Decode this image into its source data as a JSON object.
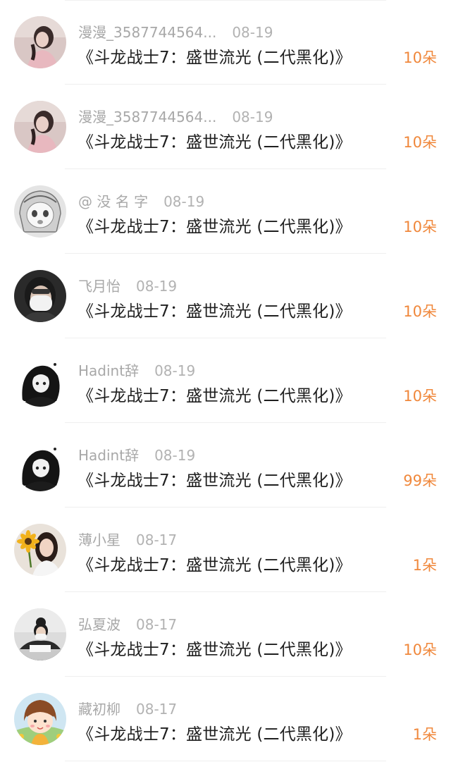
{
  "gifts": [
    {
      "user": "漫漫_3587744564...",
      "date": "08-19",
      "title": "《斗龙战士7：盛世流光 (二代黑化)》",
      "amount": "10朵",
      "avatar": "girl-pink-avatar"
    },
    {
      "user": "漫漫_3587744564...",
      "date": "08-19",
      "title": "《斗龙战士7：盛世流光 (二代黑化)》",
      "amount": "10朵",
      "avatar": "girl-pink-avatar"
    },
    {
      "user": "@ 没 名 字",
      "date": "08-19",
      "title": "《斗龙战士7：盛世流光 (二代黑化)》",
      "amount": "10朵",
      "avatar": "anime-girl-avatar"
    },
    {
      "user": "飞月怡",
      "date": "08-19",
      "title": "《斗龙战士7：盛世流光 (二代黑化)》",
      "amount": "10朵",
      "avatar": "masked-person-avatar"
    },
    {
      "user": "Hadint辞",
      "date": "08-19",
      "title": "《斗龙战士7：盛世流光 (二代黑化)》",
      "amount": "10朵",
      "avatar": "dark-anime-avatar"
    },
    {
      "user": "Hadint辞",
      "date": "08-19",
      "title": "《斗龙战士7：盛世流光 (二代黑化)》",
      "amount": "99朵",
      "avatar": "dark-anime-avatar"
    },
    {
      "user": "薄小星",
      "date": "08-17",
      "title": "《斗龙战士7：盛世流光 (二代黑化)》",
      "amount": "1朵",
      "avatar": "sunflower-girl-avatar"
    },
    {
      "user": "弘夏波",
      "date": "08-17",
      "title": "《斗龙战士7：盛世流光 (二代黑化)》",
      "amount": "10朵",
      "avatar": "person-desk-avatar"
    },
    {
      "user": "藏初柳",
      "date": "08-17",
      "title": "《斗龙战士7：盛世流光 (二代黑化)》",
      "amount": "1朵",
      "avatar": "cartoon-kid-avatar"
    }
  ],
  "colors": {
    "amount": "#f0883c",
    "meta": "#a8a8a8",
    "title": "#1f1f1f"
  }
}
